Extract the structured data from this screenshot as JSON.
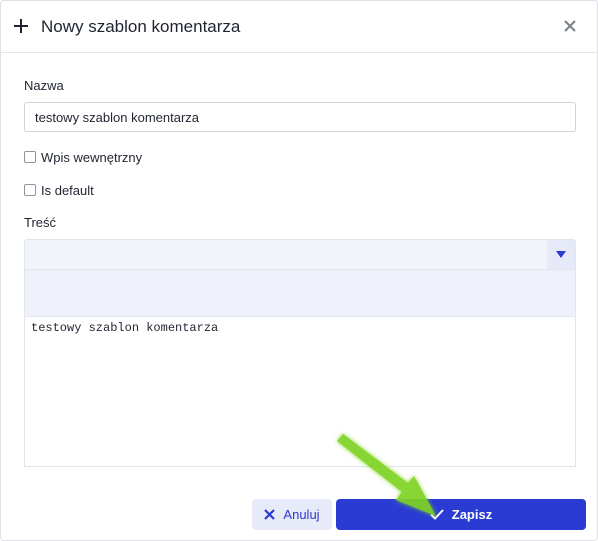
{
  "dialog": {
    "title": "Nowy szablon komentarza",
    "header_icon": "plus-icon",
    "close_icon": "close-icon"
  },
  "form": {
    "name_label": "Nazwa",
    "name_value": "testowy szablon komentarza",
    "internal_label": "Wpis wewnętrzny",
    "internal_checked": false,
    "default_label": "Is default",
    "default_checked": false,
    "content_label": "Treść",
    "select_value": "",
    "editor_text": "testowy szablon komentarza"
  },
  "buttons": {
    "cancel_label": "Anuluj",
    "cancel_icon": "x-icon",
    "save_label": "Zapisz",
    "save_icon": "check-icon"
  },
  "colors": {
    "primary": "#2a3bd4",
    "secondary_bg": "#e7eaf8",
    "annotation_arrow": "#7ed321"
  }
}
